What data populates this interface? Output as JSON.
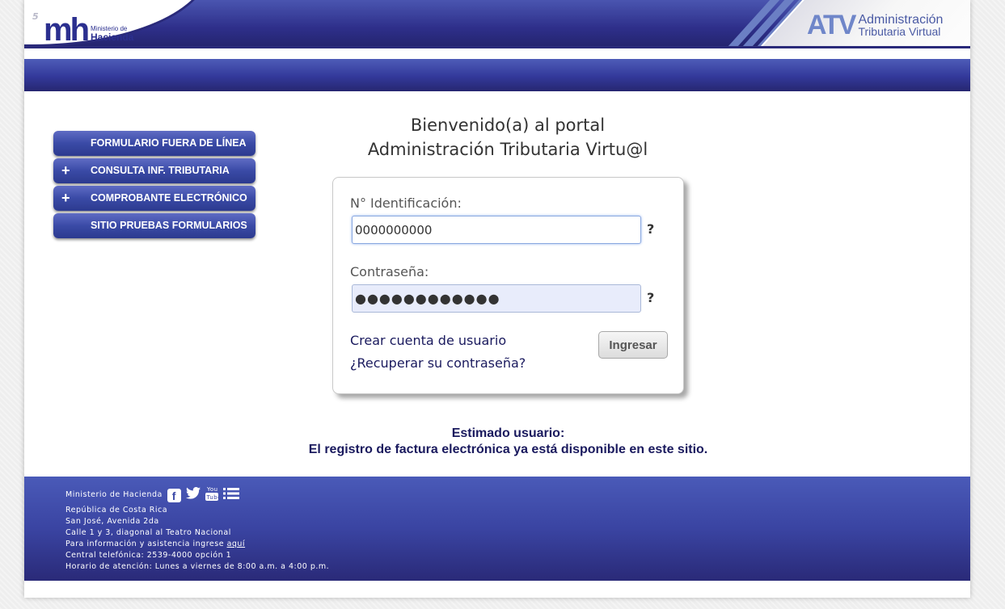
{
  "header": {
    "page_number": "5",
    "mh_logo": {
      "mark": "mh",
      "line1": "Ministerio de",
      "line2": "Hacienda"
    },
    "atv_logo": {
      "mark": "ATV",
      "line1": "Administración",
      "line2": "Tributaria Virtual"
    }
  },
  "sidebar": {
    "items": [
      {
        "label": "FORMULARIO FUERA DE LÍNEA",
        "expandable": false
      },
      {
        "label": "CONSULTA INF. TRIBUTARIA",
        "expandable": true,
        "icon": "plus-icon"
      },
      {
        "label": "COMPROBANTE ELECTRÓNICO",
        "expandable": true,
        "icon": "plus-icon"
      },
      {
        "label": "SITIO PRUEBAS FORMULARIOS",
        "expandable": false
      }
    ],
    "plus_glyph": "+"
  },
  "welcome": {
    "line1": "Bienvenido(a) al portal",
    "line2": "Administración Tributaria Virtu@l"
  },
  "login": {
    "id_label": "N° Identificación:",
    "id_value": "0000000000",
    "password_label": "Contraseña:",
    "password_value": "●●●●●●●●●●●●",
    "help_glyph": "?",
    "create_account": "Crear cuenta de usuario",
    "recover_password": "¿Recuperar su contraseña?",
    "submit_label": "Ingresar"
  },
  "notice": {
    "line1": "Estimado usuario:",
    "line2": "El registro de factura electrónica ya está disponible en este sitio."
  },
  "footer": {
    "org": "Ministerio de Hacienda",
    "social": [
      "facebook-icon",
      "twitter-icon",
      "youtube-icon",
      "list-icon"
    ],
    "country": "República de Costa Rica",
    "address1": "San José, Avenida 2da",
    "address2": "Calle 1 y 3, diagonal al Teatro Nacional",
    "info_prefix": "Para información y asistencia ingrese ",
    "info_link": "aquí",
    "phone": "Central telefónica: 2539-4000 opción 1",
    "hours": "Horario de atención: Lunes a viernes de 8:00 a.m. a 4:00 p.m."
  },
  "colors": {
    "brand_blue": "#2b2f8f",
    "band_blue": "#3a44a2",
    "accent_light_blue": "#6f86c9",
    "notice_text": "#1a1a5e"
  }
}
